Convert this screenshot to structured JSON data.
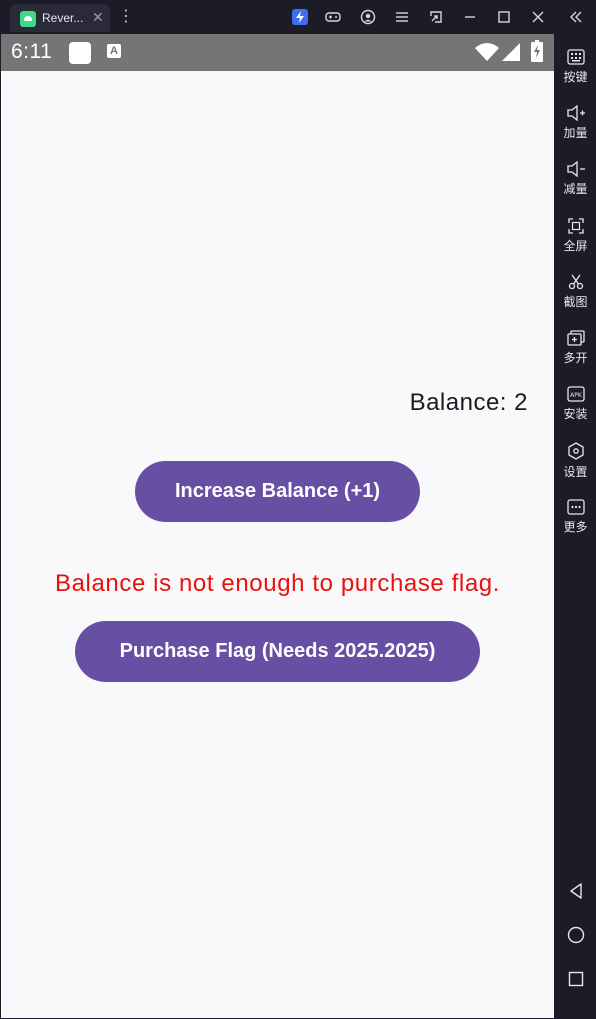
{
  "titlebar": {
    "tab_title": "Rever...",
    "tab_close": "✕",
    "kebab": "⋮",
    "icons": [
      "lightning-icon",
      "gamepad-icon",
      "account-icon",
      "menu-icon",
      "window-resize-icon",
      "minimize-icon",
      "maximize-icon",
      "close-icon",
      "collapse-sidebar-icon"
    ]
  },
  "status_bar": {
    "time": "6:11",
    "notification_letter": "A"
  },
  "app": {
    "balance_text": "Balance: 2",
    "increase_button": "Increase Balance (+1)",
    "message": "Balance is not enough to purchase flag.",
    "purchase_button": "Purchase Flag (Needs 2025.2025)",
    "colors": {
      "button": "#6750a4",
      "message": "#e8110c",
      "background": "#f9f8fb"
    }
  },
  "sidebar": {
    "items": [
      {
        "label": "按键",
        "icon": "keyboard-icon"
      },
      {
        "label": "加量",
        "icon": "volume-up-icon"
      },
      {
        "label": "减量",
        "icon": "volume-down-icon"
      },
      {
        "label": "全屏",
        "icon": "fullscreen-icon"
      },
      {
        "label": "截图",
        "icon": "scissors-icon"
      },
      {
        "label": "多开",
        "icon": "multi-instance-icon"
      },
      {
        "label": "安装",
        "icon": "apk-install-icon"
      },
      {
        "label": "设置",
        "icon": "settings-icon"
      },
      {
        "label": "更多",
        "icon": "more-icon"
      }
    ],
    "nav": [
      "back-icon",
      "home-icon",
      "recents-icon"
    ]
  }
}
